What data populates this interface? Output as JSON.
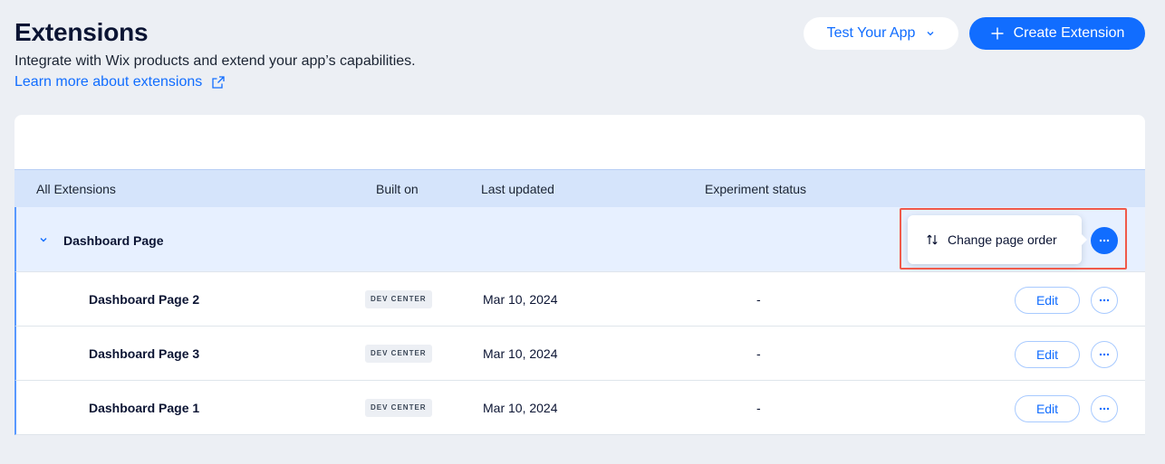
{
  "header": {
    "title": "Extensions",
    "subtitle": "Integrate with Wix products and extend your app’s capabilities.",
    "learn_more": "Learn more about extensions",
    "test_app_label": "Test Your App",
    "create_label": "Create Extension"
  },
  "table": {
    "columns": [
      "All Extensions",
      "Built on",
      "Last updated",
      "Experiment status"
    ],
    "group": {
      "name": "Dashboard Page",
      "popover_label": "Change page order"
    },
    "rows": [
      {
        "name": "Dashboard Page 2",
        "built_on": "DEV CENTER",
        "updated": "Mar 10, 2024",
        "experiment": "-",
        "edit": "Edit"
      },
      {
        "name": "Dashboard Page 3",
        "built_on": "DEV CENTER",
        "updated": "Mar 10, 2024",
        "experiment": "-",
        "edit": "Edit"
      },
      {
        "name": "Dashboard Page 1",
        "built_on": "DEV CENTER",
        "updated": "Mar 10, 2024",
        "experiment": "-",
        "edit": "Edit"
      }
    ]
  },
  "colors": {
    "accent": "#116dff",
    "header_bg": "#d5e4fb",
    "highlight": "#f05a4a",
    "page_bg": "#eceff4"
  }
}
